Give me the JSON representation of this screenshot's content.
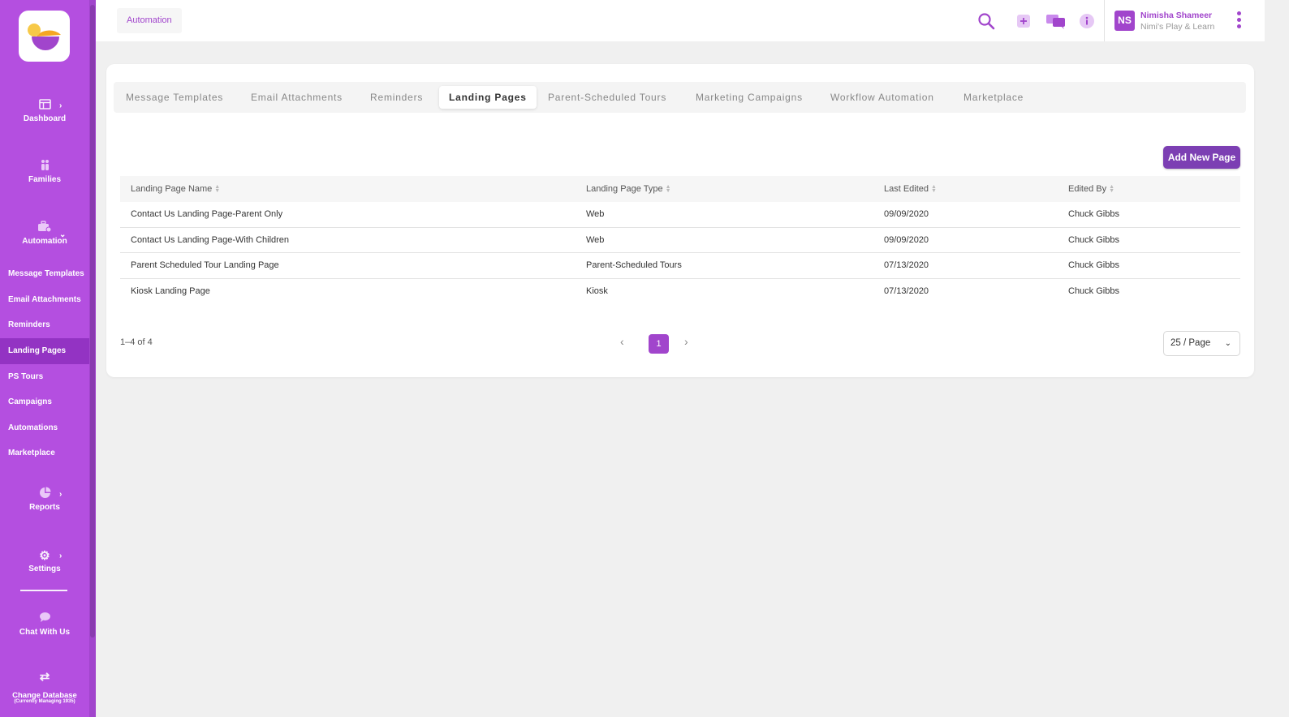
{
  "sidebar": {
    "nav": [
      {
        "label": "Dashboard",
        "icon": "dashboard-icon"
      },
      {
        "label": "Families",
        "icon": "families-icon"
      },
      {
        "label": "Automation",
        "icon": "automation-icon"
      },
      {
        "label": "Reports",
        "icon": "reports-icon"
      },
      {
        "label": "Settings",
        "icon": "settings-icon"
      },
      {
        "label": "Chat With Us",
        "icon": "chat-icon"
      }
    ],
    "sub_items": [
      "Message Templates",
      "Email Attachments",
      "Reminders",
      "Landing Pages",
      "PS Tours",
      "Campaigns",
      "Automations",
      "Marketplace"
    ],
    "active_sub": "Landing Pages",
    "change_db": {
      "label": "Change Database",
      "sub": "(Currently Managing 1935)"
    }
  },
  "header": {
    "breadcrumb": "Automation",
    "user_initials": "NS",
    "user_name": "Nimisha Shameer",
    "user_org": "Nimi's Play & Learn"
  },
  "tabs": [
    "Message Templates",
    "Email Attachments",
    "Reminders",
    "Landing Pages",
    "Parent-Scheduled Tours",
    "Marketing Campaigns",
    "Workflow Automation",
    "Marketplace"
  ],
  "active_tab": "Landing Pages",
  "add_button": "Add New Page",
  "table": {
    "headers": [
      "Landing Page Name",
      "Landing Page Type",
      "Last Edited",
      "Edited By"
    ],
    "rows": [
      [
        "Contact Us Landing Page-Parent Only",
        "Web",
        "09/09/2020",
        "Chuck Gibbs"
      ],
      [
        "Contact Us Landing Page-With Children",
        "Web",
        "09/09/2020",
        "Chuck Gibbs"
      ],
      [
        "Parent Scheduled Tour Landing Page",
        "Parent-Scheduled Tours",
        "07/13/2020",
        "Chuck Gibbs"
      ],
      [
        "Kiosk Landing Page",
        "Kiosk",
        "07/13/2020",
        "Chuck Gibbs"
      ]
    ]
  },
  "pagination": {
    "range": "1–4 of 4",
    "current_page": "1",
    "page_size": "25 / Page"
  },
  "colors": {
    "accent": "#b44fe0",
    "active_sub_bg": "#9333c3",
    "button": "#7c3fb3"
  }
}
